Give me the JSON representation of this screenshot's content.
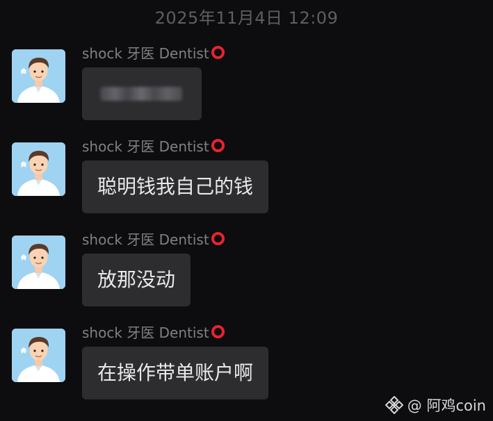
{
  "chat": {
    "timestamp": "2025年11月4日 12:09",
    "messages": [
      {
        "sender": "shock 牙医 Dentist",
        "text": ""
      },
      {
        "sender": "shock 牙医 Dentist",
        "text": "聪明钱我自己的钱"
      },
      {
        "sender": "shock 牙医 Dentist",
        "text": "放那没动"
      },
      {
        "sender": "shock 牙医 Dentist",
        "text": "在操作带单账户啊"
      }
    ]
  },
  "watermark": {
    "text": "@ 阿鸡coin",
    "icon": "binance-logo-icon"
  },
  "colors": {
    "background": "#0d0d0f",
    "bubble": "#2d2d30",
    "badge_ring": "#e8232e",
    "avatar_bg": "#9fd3f2"
  }
}
